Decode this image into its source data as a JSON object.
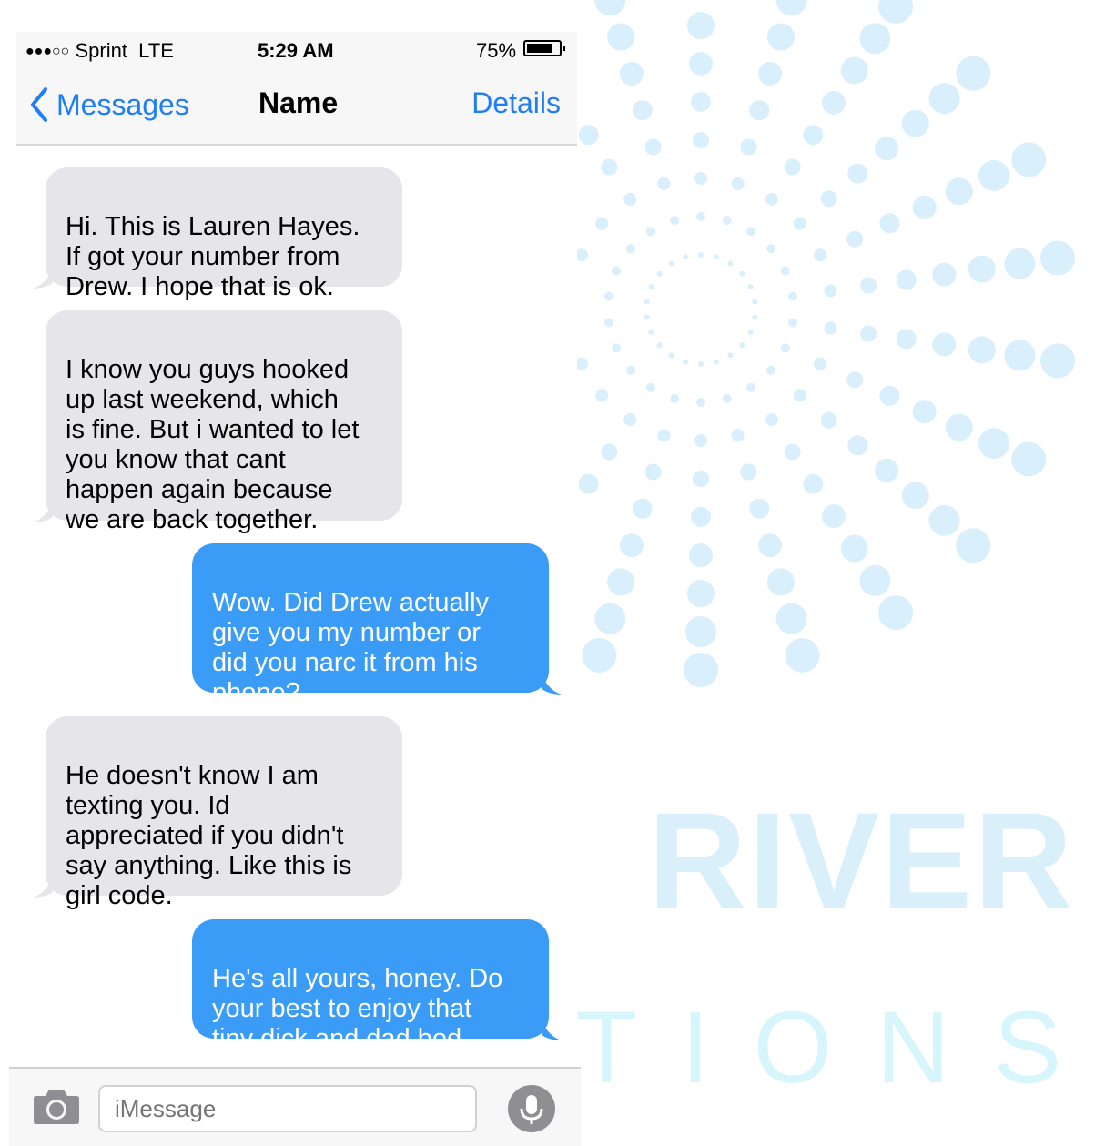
{
  "status_bar": {
    "signal_dots": "●●●○○",
    "carrier": "Sprint",
    "network": "LTE",
    "time": "5:29 AM",
    "battery_percent": "75%",
    "battery_level": 0.75
  },
  "nav": {
    "back_label": "Messages",
    "title": "Name",
    "details_label": "Details"
  },
  "messages": [
    {
      "direction": "received",
      "text": "Hi. This is Lauren Hayes.\nIf got your number from\nDrew. I hope that is ok."
    },
    {
      "direction": "received",
      "text": "I know you guys hooked\nup last weekend, which\nis fine. But i wanted to let\nyou know that cant\nhappen again because\nwe are back together."
    },
    {
      "direction": "sent",
      "text": "Wow. Did Drew actually\ngive you my number or\ndid you narc it from his\nphone?"
    },
    {
      "direction": "received",
      "text": "He doesn't know I am\ntexting you. Id\nappreciated if you didn't\nsay anything. Like this is\ngirl code."
    },
    {
      "direction": "sent",
      "text": "He's all yours, honey. Do\nyour best to enjoy that\ntiny dick and dad bod."
    }
  ],
  "input": {
    "placeholder": "iMessage"
  },
  "watermark": {
    "word1": "RIVER",
    "word2": "TIONS"
  },
  "colors": {
    "accent": "#1f7ef5",
    "sent_bubble": "#3b9cf7",
    "received_bubble": "#e5e5ea",
    "watermark": "#d9f0fb"
  }
}
